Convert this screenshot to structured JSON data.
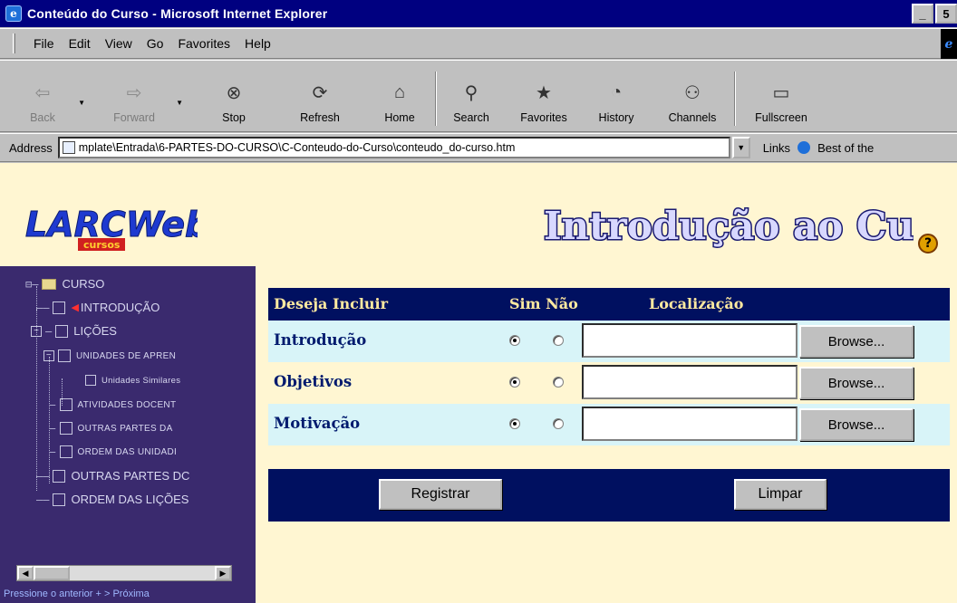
{
  "window": {
    "title": "Conteúdo do Curso - Microsoft Internet Explorer",
    "minimize": "_",
    "restore": "5"
  },
  "menu": {
    "items": [
      "File",
      "Edit",
      "View",
      "Go",
      "Favorites",
      "Help"
    ]
  },
  "toolbar": {
    "buttons": [
      {
        "label": "Back",
        "icon": "back-arrow-icon"
      },
      {
        "label": "Forward",
        "icon": "forward-arrow-icon"
      },
      {
        "label": "Stop",
        "icon": "stop-icon"
      },
      {
        "label": "Refresh",
        "icon": "refresh-icon"
      },
      {
        "label": "Home",
        "icon": "home-icon"
      },
      {
        "label": "Search",
        "icon": "search-icon"
      },
      {
        "label": "Favorites",
        "icon": "favorites-icon"
      },
      {
        "label": "History",
        "icon": "history-icon"
      },
      {
        "label": "Channels",
        "icon": "channels-icon"
      },
      {
        "label": "Fullscreen",
        "icon": "fullscreen-icon"
      }
    ]
  },
  "address": {
    "label": "Address",
    "url": "mplate\\Entrada\\6-PARTES-DO-CURSO\\C-Conteudo-do-Curso\\conteudo_do-curso.htm",
    "links_label": "Links",
    "link1": "Best of the"
  },
  "page": {
    "logo_text": "LARCWeb",
    "logo_sub": "cursos",
    "banner": "Introdução ao Curso",
    "help": "?"
  },
  "tree": {
    "root": "CURSO",
    "introducao": "INTRODUÇÃO",
    "licoes": "LIÇÕES",
    "unidades": "UNIDADES DE APREN",
    "unidades_similares": "Unidades Similares",
    "atividades": "ATIVIDADES DOCENT",
    "outras_partes_1": "OUTRAS PARTES DA",
    "ordem_unidades": "ORDEM DAS UNIDADI",
    "outras_partes_2": "OUTRAS PARTES DC",
    "ordem_licoes": "ORDEM DAS LIÇÕES",
    "footer": "Pressione o anterior   +   > Próxima"
  },
  "form": {
    "headers": {
      "deseja": "Deseja Incluir",
      "sim_nao": "Sim Não",
      "localizacao": "Localização"
    },
    "rows": [
      {
        "label": "Introdução",
        "sim": true,
        "value": "",
        "browse": "Browse..."
      },
      {
        "label": "Objetivos",
        "sim": true,
        "value": "",
        "browse": "Browse..."
      },
      {
        "label": "Motivação",
        "sim": true,
        "value": "",
        "browse": "Browse..."
      }
    ],
    "registrar": "Registrar",
    "limpar": "Limpar"
  },
  "colors": {
    "title_bar": "#000080",
    "page_bg": "#fff6d2",
    "tree_bg": "#3a2a6e",
    "form_header": "#001060",
    "row_cyan": "#d8f4f8",
    "label_text": "#001a6e"
  }
}
